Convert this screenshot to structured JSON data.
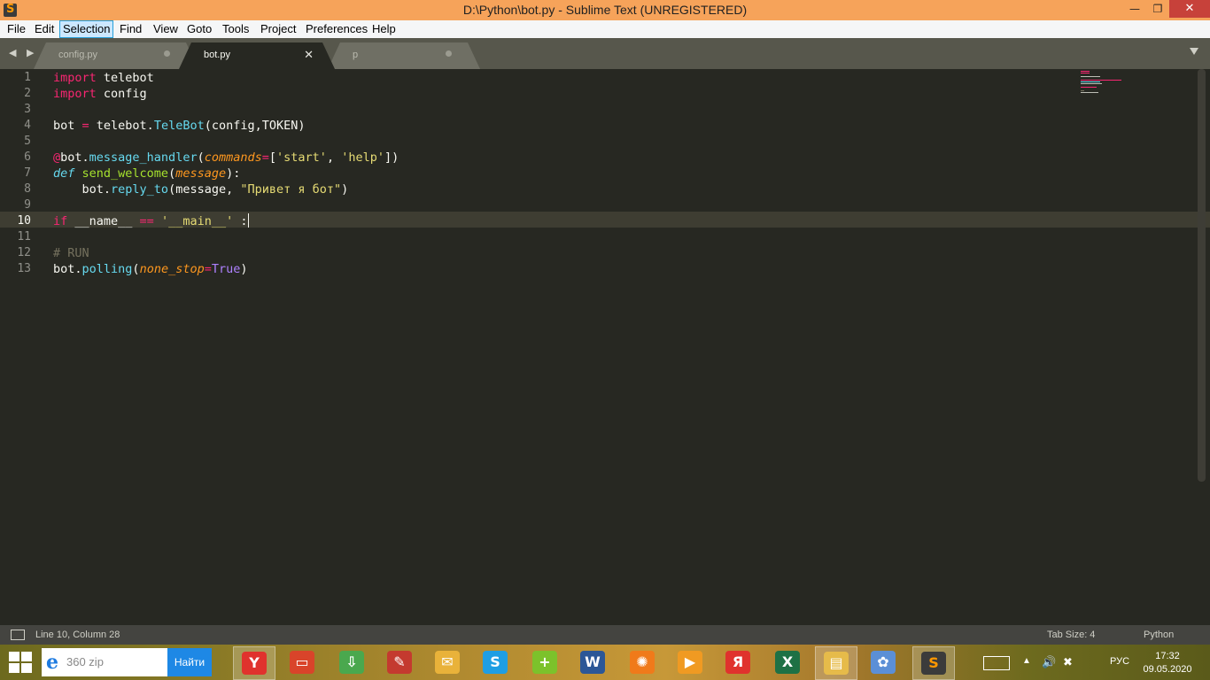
{
  "window": {
    "title": "D:\\Python\\bot.py - Sublime Text (UNREGISTERED)",
    "minimize_glyph": "—",
    "maximize_glyph": "❐",
    "close_glyph": "✕"
  },
  "menu": [
    "File",
    "Edit",
    "Selection",
    "Find",
    "View",
    "Goto",
    "Tools",
    "Project",
    "Preferences",
    "Help"
  ],
  "menu_active": "Selection",
  "tabs": [
    {
      "label": "config.py",
      "state": "unsaved",
      "active": false
    },
    {
      "label": "bot.py",
      "state": "close",
      "active": true
    },
    {
      "label": "p",
      "state": "unsaved",
      "active": false
    }
  ],
  "tab_nav": "◀ ▶",
  "tab_close_glyph": "✕",
  "editor": {
    "line_numbers": [
      "1",
      "2",
      "3",
      "4",
      "5",
      "6",
      "7",
      "8",
      "9",
      "10",
      "11",
      "12",
      "13"
    ],
    "current_line": 10,
    "lines": [
      [
        {
          "t": "import",
          "c": "kw"
        },
        {
          "t": " telebot"
        }
      ],
      [
        {
          "t": "import",
          "c": "kw"
        },
        {
          "t": " config"
        }
      ],
      [],
      [
        {
          "t": "bot "
        },
        {
          "t": "=",
          "c": "kw"
        },
        {
          "t": " telebot."
        },
        {
          "t": "TeleBot",
          "c": "sb"
        },
        {
          "t": "(config,TOKEN)"
        }
      ],
      [],
      [
        {
          "t": "@",
          "c": "kw"
        },
        {
          "t": "bot."
        },
        {
          "t": "message_handler",
          "c": "sb"
        },
        {
          "t": "("
        },
        {
          "t": "commands",
          "c": "pa"
        },
        {
          "t": "=",
          "c": "kw"
        },
        {
          "t": "["
        },
        {
          "t": "'start'",
          "c": "st"
        },
        {
          "t": ", "
        },
        {
          "t": "'help'",
          "c": "st"
        },
        {
          "t": "])"
        }
      ],
      [
        {
          "t": "def",
          "c": "df"
        },
        {
          "t": " "
        },
        {
          "t": "send_welcome",
          "c": "fn"
        },
        {
          "t": "("
        },
        {
          "t": "message",
          "c": "pa"
        },
        {
          "t": "):"
        }
      ],
      [
        {
          "t": "    bot."
        },
        {
          "t": "reply_to",
          "c": "sb"
        },
        {
          "t": "(message, "
        },
        {
          "t": "\"Привет я бот\"",
          "c": "st"
        },
        {
          "t": ")"
        }
      ],
      [],
      [
        {
          "t": "if",
          "c": "kw"
        },
        {
          "t": " __name__ "
        },
        {
          "t": "==",
          "c": "kw"
        },
        {
          "t": " "
        },
        {
          "t": "'__main__'",
          "c": "st"
        },
        {
          "t": " :"
        }
      ],
      [],
      [
        {
          "t": "# RUN",
          "c": "cm"
        }
      ],
      [
        {
          "t": "bot."
        },
        {
          "t": "polling",
          "c": "sb"
        },
        {
          "t": "("
        },
        {
          "t": "none_stop",
          "c": "pa"
        },
        {
          "t": "=",
          "c": "kw"
        },
        {
          "t": "True",
          "c": "nm"
        },
        {
          "t": ")"
        }
      ]
    ]
  },
  "status": {
    "position": "Line 10, Column 28",
    "tab_size": "Tab Size: 4",
    "syntax": "Python"
  },
  "taskbar": {
    "search_placeholder": "360 zip",
    "search_button": "Найти",
    "apps": [
      {
        "name": "yandex-browser-icon",
        "glyph": "Y",
        "color": "#e0322d",
        "running": true
      },
      {
        "name": "presentation-icon",
        "glyph": "▭",
        "color": "#d9442a",
        "running": false
      },
      {
        "name": "download-icon",
        "glyph": "⇩",
        "color": "#4aa84e",
        "running": false
      },
      {
        "name": "pdf-icon",
        "glyph": "✎",
        "color": "#c43a2f",
        "running": false
      },
      {
        "name": "mail-icon",
        "glyph": "✉",
        "color": "#e9b23a",
        "running": false
      },
      {
        "name": "skype-icon",
        "glyph": "S",
        "color": "#1f9ee3",
        "running": false
      },
      {
        "name": "plus-app-icon",
        "glyph": "+",
        "color": "#7cc22b",
        "running": false
      },
      {
        "name": "word-icon",
        "glyph": "W",
        "color": "#2b5797",
        "running": false
      },
      {
        "name": "wheel-icon",
        "glyph": "✺",
        "color": "#f07a1a",
        "running": false
      },
      {
        "name": "media-player-icon",
        "glyph": "▶",
        "color": "#f09a22",
        "running": false
      },
      {
        "name": "yandex-icon",
        "glyph": "Я",
        "color": "#e0322d",
        "running": false
      },
      {
        "name": "excel-icon",
        "glyph": "X",
        "color": "#1e7145",
        "running": false
      },
      {
        "name": "file-explorer-icon",
        "glyph": "▤",
        "color": "#e6bb4a",
        "running": true
      },
      {
        "name": "paint-icon",
        "glyph": "✿",
        "color": "#5b8fd6",
        "running": false
      },
      {
        "name": "sublime-text-icon",
        "glyph": "S",
        "color": "#3b3b3b",
        "running": true
      }
    ],
    "tray_up": "▲",
    "tray_volume": "🔊",
    "tray_network": "✖",
    "language": "РУС",
    "time": "17:32",
    "date": "09.05.2020"
  },
  "colors": {
    "editor_bg": "#272822",
    "keyword": "#f92672",
    "function": "#a6e22e",
    "string": "#e6db74",
    "param": "#fd971f",
    "support": "#66d9ef",
    "comment": "#75715e",
    "constant": "#ae81ff"
  }
}
